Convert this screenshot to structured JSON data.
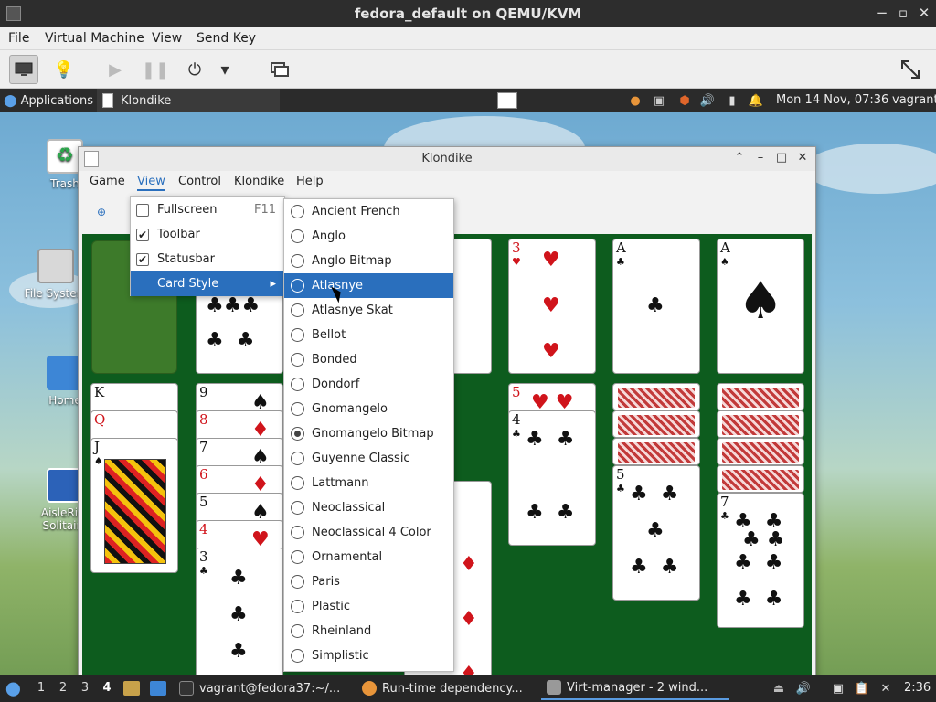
{
  "host": {
    "title": "fedora_default on QEMU/KVM",
    "menu": [
      "File",
      "Virtual Machine",
      "View",
      "Send Key"
    ]
  },
  "guest_panel": {
    "applications": "Applications",
    "task": "Klondike",
    "clock": "Mon 14 Nov, 07:36",
    "user": "vagrant"
  },
  "desktop_icons": [
    "Trash",
    "File System",
    "Home",
    "AisleRiot Solitaire"
  ],
  "klondike": {
    "title": "Klondike",
    "menu": [
      "Game",
      "View",
      "Control",
      "Klondike",
      "Help"
    ],
    "active_menu": "View"
  },
  "view_menu": {
    "items": [
      {
        "label": "Fullscreen",
        "accel": "F11",
        "checked": false
      },
      {
        "label": "Toolbar",
        "checked": true
      },
      {
        "label": "Statusbar",
        "checked": true
      },
      {
        "label": "Card Style",
        "submenu": true
      }
    ],
    "selected": "Card Style"
  },
  "card_style_menu": {
    "items": [
      "Ancient French",
      "Anglo",
      "Anglo Bitmap",
      "Atlasnye",
      "Atlasnye Skat",
      "Bellot",
      "Bonded",
      "Dondorf",
      "Gnomangelo",
      "Gnomangelo Bitmap",
      "Guyenne Classic",
      "Lattmann",
      "Neoclassical",
      "Neoclassical 4 Color",
      "Ornamental",
      "Paris",
      "Plastic",
      "Rheinland",
      "Simplistic"
    ],
    "hovered": "Atlasnye",
    "checked": "Gnomangelo Bitmap"
  },
  "foundation_cards": [
    {
      "rank": "3",
      "suit": "♥"
    },
    {
      "rank": "A",
      "suit": "♣"
    },
    {
      "rank": "A",
      "suit": "♠"
    }
  ],
  "tableau": {
    "col1": [
      "K",
      "Q",
      "J"
    ],
    "col2": [
      "9",
      "8",
      "7",
      "6",
      "5",
      "4",
      "3"
    ],
    "col5": [
      "5",
      "4"
    ],
    "col6": [
      "5"
    ],
    "col7": [
      "7"
    ]
  },
  "bottom_panel": {
    "workspaces": [
      "1",
      "2",
      "3",
      "4"
    ],
    "active_workspace": "4",
    "tasks": [
      "vagrant@fedora37:~/...",
      "Run-time dependency...",
      "Virt-manager - 2 wind..."
    ],
    "clock": "2:36"
  },
  "colors": {
    "felt": "#0d5c1e",
    "selection": "#2a6fbd",
    "red_suit": "#d0141b"
  }
}
